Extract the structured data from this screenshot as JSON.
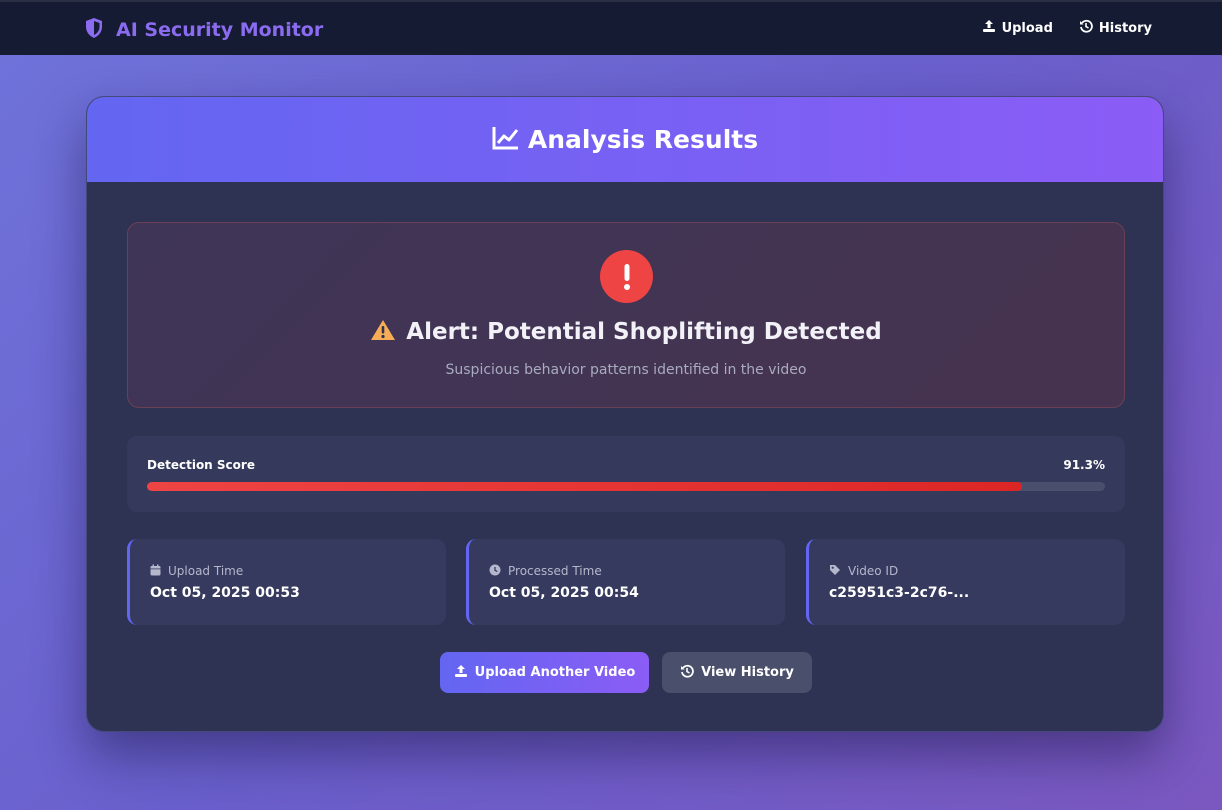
{
  "app": {
    "title": "AI Security Monitor",
    "brand_icon": "shield-icon"
  },
  "nav": {
    "upload": {
      "label": "Upload",
      "icon": "upload-icon"
    },
    "history": {
      "label": "History",
      "icon": "history-icon"
    }
  },
  "results": {
    "title": "Analysis Results",
    "title_icon": "chart-line-icon"
  },
  "alert": {
    "icon": "exclamation-icon",
    "warning_icon": "warning-icon",
    "title": "Alert: Potential Shoplifting Detected",
    "subtitle": "Suspicious behavior patterns identified in the video",
    "color": "#ef4444"
  },
  "score": {
    "label": "Detection Score",
    "value_text": "91.3%",
    "value": 0.913
  },
  "info": [
    {
      "icon": "calendar-icon",
      "label": "Upload Time",
      "value": "Oct 05, 2025 00:53"
    },
    {
      "icon": "clock-icon",
      "label": "Processed Time",
      "value": "Oct 05, 2025 00:54"
    },
    {
      "icon": "tag-icon",
      "label": "Video ID",
      "value": "c25951c3-2c76-..."
    }
  ],
  "actions": {
    "upload_another": {
      "label": "Upload Another Video",
      "icon": "upload-icon"
    },
    "view_history": {
      "label": "View History",
      "icon": "history-icon"
    }
  },
  "colors": {
    "accent": "#6366f1",
    "accent_end": "#8b5cf6",
    "danger": "#ef4444",
    "topbar": "#151b33",
    "card": "#2e3354"
  }
}
